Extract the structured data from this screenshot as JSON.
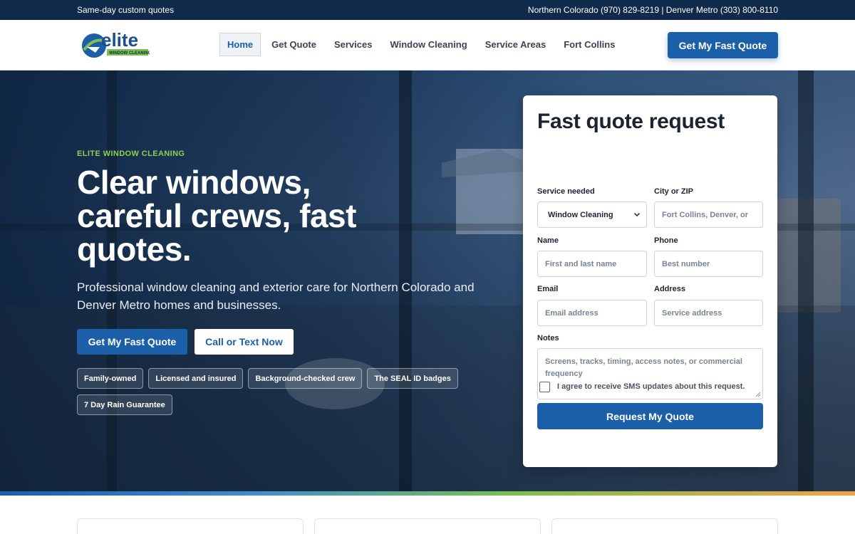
{
  "topbar": {
    "left_text": "Same-day custom quotes",
    "right_text": "Northern Colorado (970) 829-8219 | Denver Metro (303) 800-8110"
  },
  "header": {
    "logo": {
      "word": "elite",
      "tagline": "WINDOW CLEANING"
    },
    "nav": [
      {
        "label": "Home",
        "active": true
      },
      {
        "label": "Get Quote",
        "active": false
      },
      {
        "label": "Services",
        "active": false
      },
      {
        "label": "Window Cleaning",
        "active": false
      },
      {
        "label": "Service Areas",
        "active": false
      },
      {
        "label": "Fort Collins",
        "active": false
      }
    ],
    "cta_label": "Get My Fast Quote"
  },
  "hero": {
    "eyebrow": "ELITE WINDOW CLEANING",
    "title": "Clear windows, careful crews, fast quotes.",
    "subtitle": "Professional window cleaning and exterior care for Northern Colorado and Denver Metro homes and businesses.",
    "primary_button": "Get My Fast Quote",
    "secondary_button": "Call or Text Now",
    "badges": [
      "Family-owned",
      "Licensed and insured",
      "Background-checked crew",
      "The SEAL ID badges",
      "7 Day Rain Guarantee"
    ]
  },
  "quote_form": {
    "title": "Fast quote request",
    "service": {
      "label": "Service needed",
      "value": "Window Cleaning"
    },
    "city": {
      "label": "City or ZIP",
      "placeholder": "Fort Collins, Denver, or"
    },
    "name": {
      "label": "Name",
      "placeholder": "First and last name"
    },
    "phone": {
      "label": "Phone",
      "placeholder": "Best number"
    },
    "email": {
      "label": "Email",
      "placeholder": "Email address"
    },
    "address": {
      "label": "Address",
      "placeholder": "Service address"
    },
    "notes": {
      "label": "Notes",
      "placeholder": "Screens, tracks, timing, access notes, or commercial frequency"
    },
    "sms_consent": {
      "label": "I agree to receive SMS updates about this request.",
      "checked": false
    },
    "submit_label": "Request My Quote"
  },
  "colors": {
    "brand_blue": "#1b5fa8",
    "topbar": "#0f2a4a",
    "accent_green": "#8fd14f",
    "accent_orange": "#f2a14b"
  }
}
